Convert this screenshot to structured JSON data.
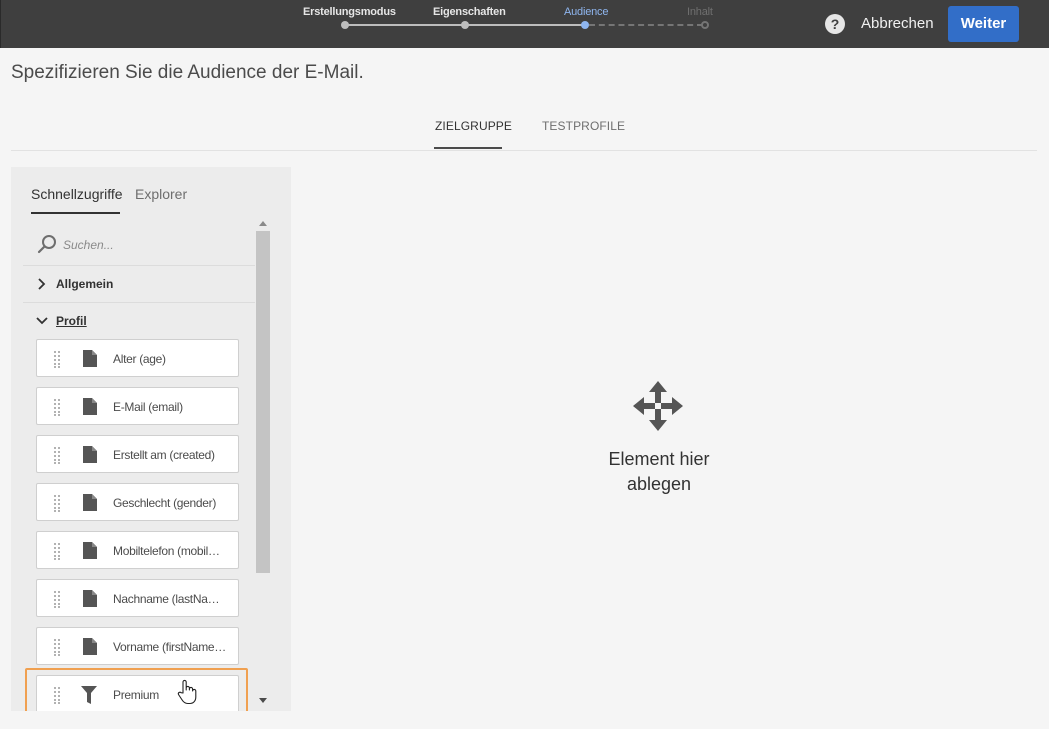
{
  "wizard": {
    "steps": [
      {
        "label": "Erstellungsmodus",
        "state": "done"
      },
      {
        "label": "Eigenschaften",
        "state": "done"
      },
      {
        "label": "Audience",
        "state": "active"
      },
      {
        "label": "Inhalt",
        "state": "future"
      }
    ],
    "help_icon": "?",
    "cancel_label": "Abbrechen",
    "next_label": "Weiter"
  },
  "page": {
    "title": "Spezifizieren Sie die Audience der E-Mail."
  },
  "tabs": [
    {
      "label": "ZIELGRUPPE",
      "active": true
    },
    {
      "label": "TESTPROFILE",
      "active": false
    }
  ],
  "panel": {
    "tabs": [
      {
        "label": "Schnellzugriffe",
        "active": true
      },
      {
        "label": "Explorer",
        "active": false
      }
    ],
    "search": {
      "placeholder": "Suchen...",
      "value": ""
    },
    "sections": [
      {
        "label": "Allgemein",
        "expanded": false
      },
      {
        "label": "Profil",
        "expanded": true
      }
    ],
    "items": [
      {
        "label": "Alter (age)",
        "icon": "document-icon"
      },
      {
        "label": "E-Mail (email)",
        "icon": "document-icon"
      },
      {
        "label": "Erstellt am (created)",
        "icon": "document-icon"
      },
      {
        "label": "Geschlecht (gender)",
        "icon": "document-icon"
      },
      {
        "label": "Mobiltelefon (mobil…",
        "icon": "document-icon"
      },
      {
        "label": "Nachname (lastNa…",
        "icon": "document-icon"
      },
      {
        "label": "Vorname (firstName…",
        "icon": "document-icon"
      },
      {
        "label": "Premium",
        "icon": "filter-icon",
        "highlighted": true
      }
    ]
  },
  "drop_zone": {
    "line1": "Element hier",
    "line2": "ablegen",
    "icon": "move-arrows-icon"
  },
  "colors": {
    "topbar": "#3f3f3f",
    "primary_button": "#326ec8",
    "active_step": "#8fb6ef",
    "highlight_border": "#f0a050"
  }
}
